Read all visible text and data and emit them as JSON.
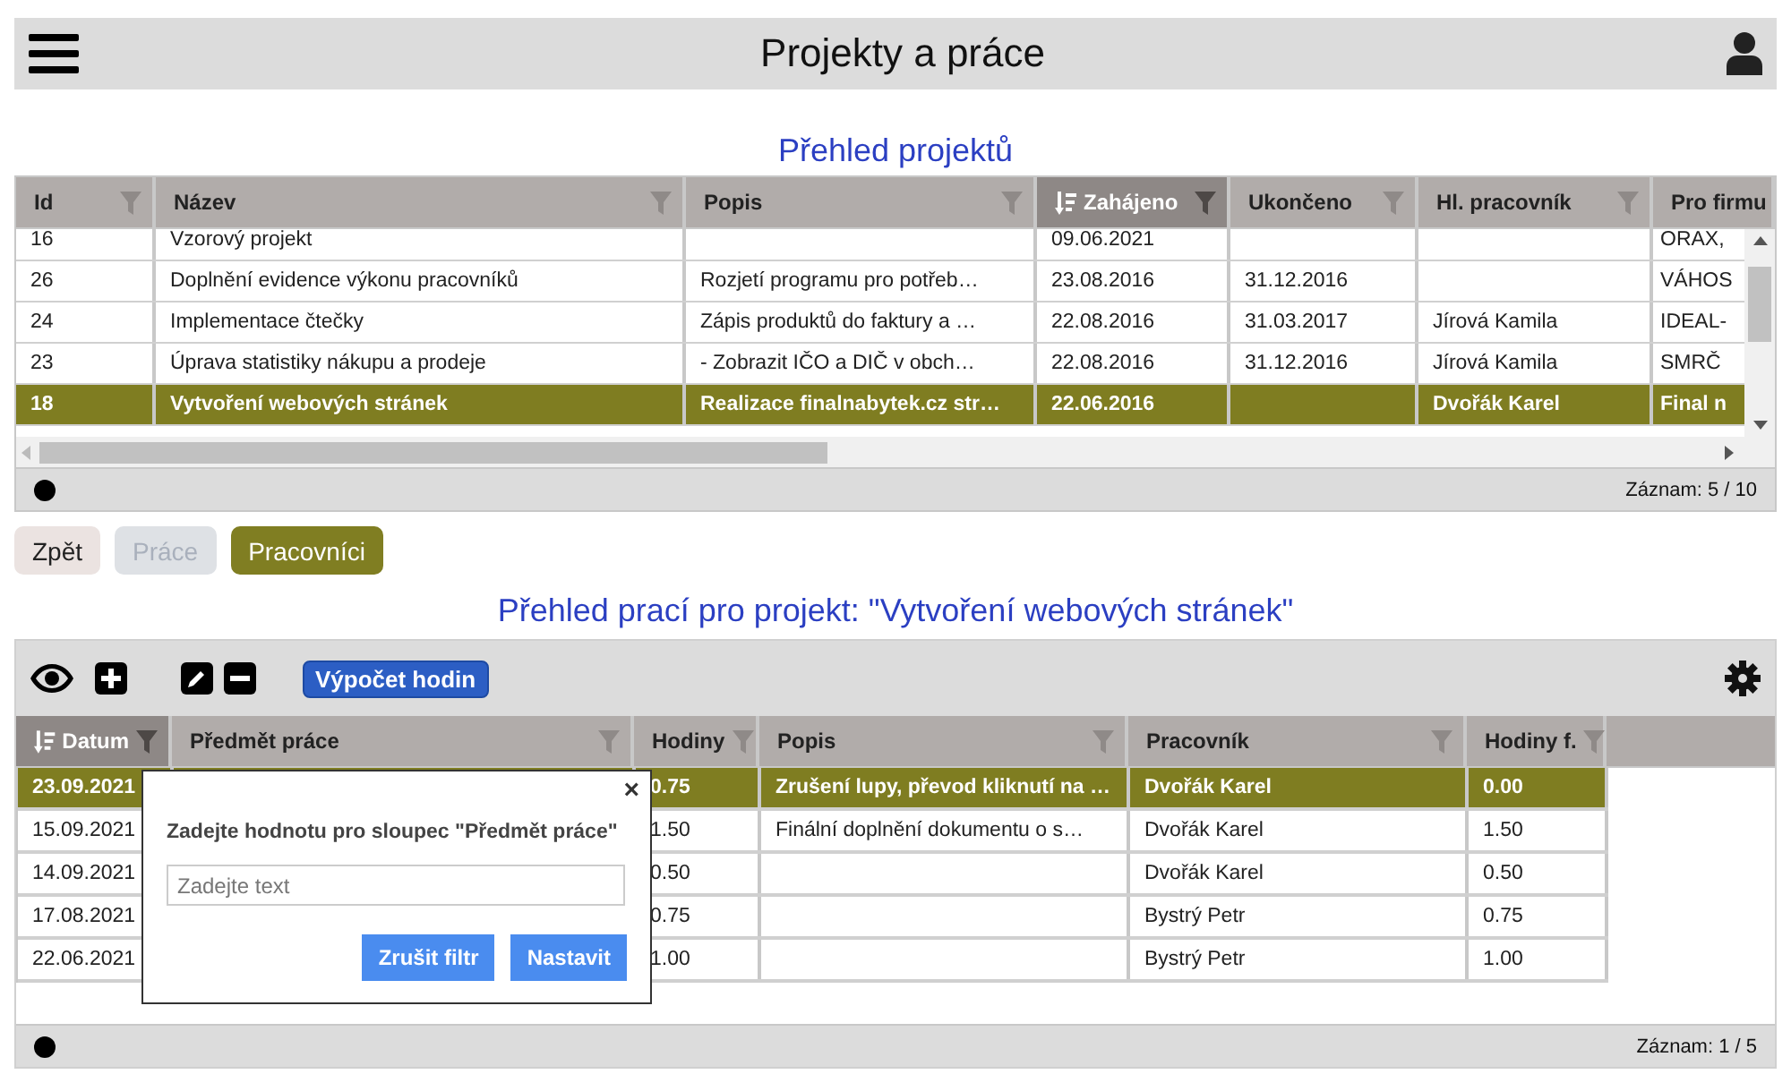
{
  "app": {
    "title": "Projekty a práce"
  },
  "projects": {
    "title": "Přehled projektů",
    "columns": [
      {
        "label": "Id",
        "sorted": false
      },
      {
        "label": "Název",
        "sorted": false
      },
      {
        "label": "Popis",
        "sorted": false
      },
      {
        "label": "Zahájeno",
        "sorted": true
      },
      {
        "label": "Ukončeno",
        "sorted": false
      },
      {
        "label": "Hl. pracovník",
        "sorted": false
      },
      {
        "label": "Pro firmu",
        "sorted": false
      }
    ],
    "rows": [
      {
        "selected": false,
        "id": "16",
        "nazev": "Vzorový projekt",
        "zahajeno": "09.06.2021",
        "pro_firmu": "ORAX,"
      },
      {
        "selected": false,
        "id": "26",
        "nazev": "Doplnění evidence výkonu pracovníků",
        "popis": "Rozjetí programu pro potřeb…",
        "zahajeno": "23.08.2016",
        "ukonceno": "31.12.2016",
        "pro_firmu": "VÁHOS"
      },
      {
        "selected": false,
        "id": "24",
        "nazev": "Implementace čtečky",
        "popis": "Zápis produktů do faktury a …",
        "zahajeno": "22.08.2016",
        "ukonceno": "31.03.2017",
        "hl_pracovnik": "Jírová Kamila",
        "pro_firmu": "IDEAL-"
      },
      {
        "selected": false,
        "id": "23",
        "nazev": "Úprava statistiky nákupu a prodeje",
        "popis": "- Zobrazit IČO a DIČ v obch…",
        "zahajeno": "22.08.2016",
        "ukonceno": "31.12.2016",
        "hl_pracovnik": "Jírová Kamila",
        "pro_firmu": "SMRČ"
      },
      {
        "selected": true,
        "id": "18",
        "nazev": "Vytvoření webových stránek",
        "popis": "Realizace finalnabytek.cz str…",
        "zahajeno": "22.06.2016",
        "hl_pracovnik": "Dvořák Karel",
        "pro_firmu": "Final n"
      }
    ],
    "record": "Záznam: 5 / 10"
  },
  "actions": [
    {
      "label": "Zpět",
      "kind": "back",
      "selected": false,
      "disabled": false
    },
    {
      "label": "Práce",
      "kind": "view",
      "selected": false,
      "disabled": true
    },
    {
      "label": "Pracovníci",
      "kind": "view",
      "selected": true,
      "disabled": false
    }
  ],
  "works": {
    "title": "Přehled prací pro projekt: \"Vytvoření webových stránek\"",
    "calc_button": "Výpočet hodin",
    "columns": [
      {
        "label": "Datum",
        "sorted": true
      },
      {
        "label": "Předmět práce",
        "sorted": false
      },
      {
        "label": "Hodiny",
        "sorted": false
      },
      {
        "label": "Popis",
        "sorted": false
      },
      {
        "label": "Pracovník",
        "sorted": false
      },
      {
        "label": "Hodiny f.",
        "sorted": false
      }
    ],
    "rows": [
      {
        "selected": true,
        "datum": "23.09.2021",
        "hodiny": "0.75",
        "popis": "Zrušení lupy, převod kliknutí na …",
        "pracovnik": "Dvořák Karel",
        "hodiny_f": "0.00"
      },
      {
        "selected": false,
        "datum": "15.09.2021",
        "hodiny": "1.50",
        "popis": "Finální doplnění dokumentu o s…",
        "pracovnik": "Dvořák Karel",
        "hodiny_f": "1.50"
      },
      {
        "selected": false,
        "datum": "14.09.2021",
        "hodiny": "0.50",
        "pracovnik": "Dvořák Karel",
        "hodiny_f": "0.50"
      },
      {
        "selected": false,
        "datum": "17.08.2021",
        "hodiny": "0.75",
        "pracovnik": "Bystrý Petr",
        "hodiny_f": "0.75"
      },
      {
        "selected": false,
        "datum": "22.06.2021",
        "hodiny": "1.00",
        "pracovnik": "Bystrý Petr",
        "hodiny_f": "1.00"
      }
    ],
    "record": "Záznam: 1 / 5",
    "filter_popup": {
      "close": "×",
      "label": "Zadejte hodnotu pro sloupec \"Předmět práce\"",
      "placeholder": "Zadejte text",
      "buttons": [
        "Zrušit filtr",
        "Nastavit"
      ]
    }
  }
}
